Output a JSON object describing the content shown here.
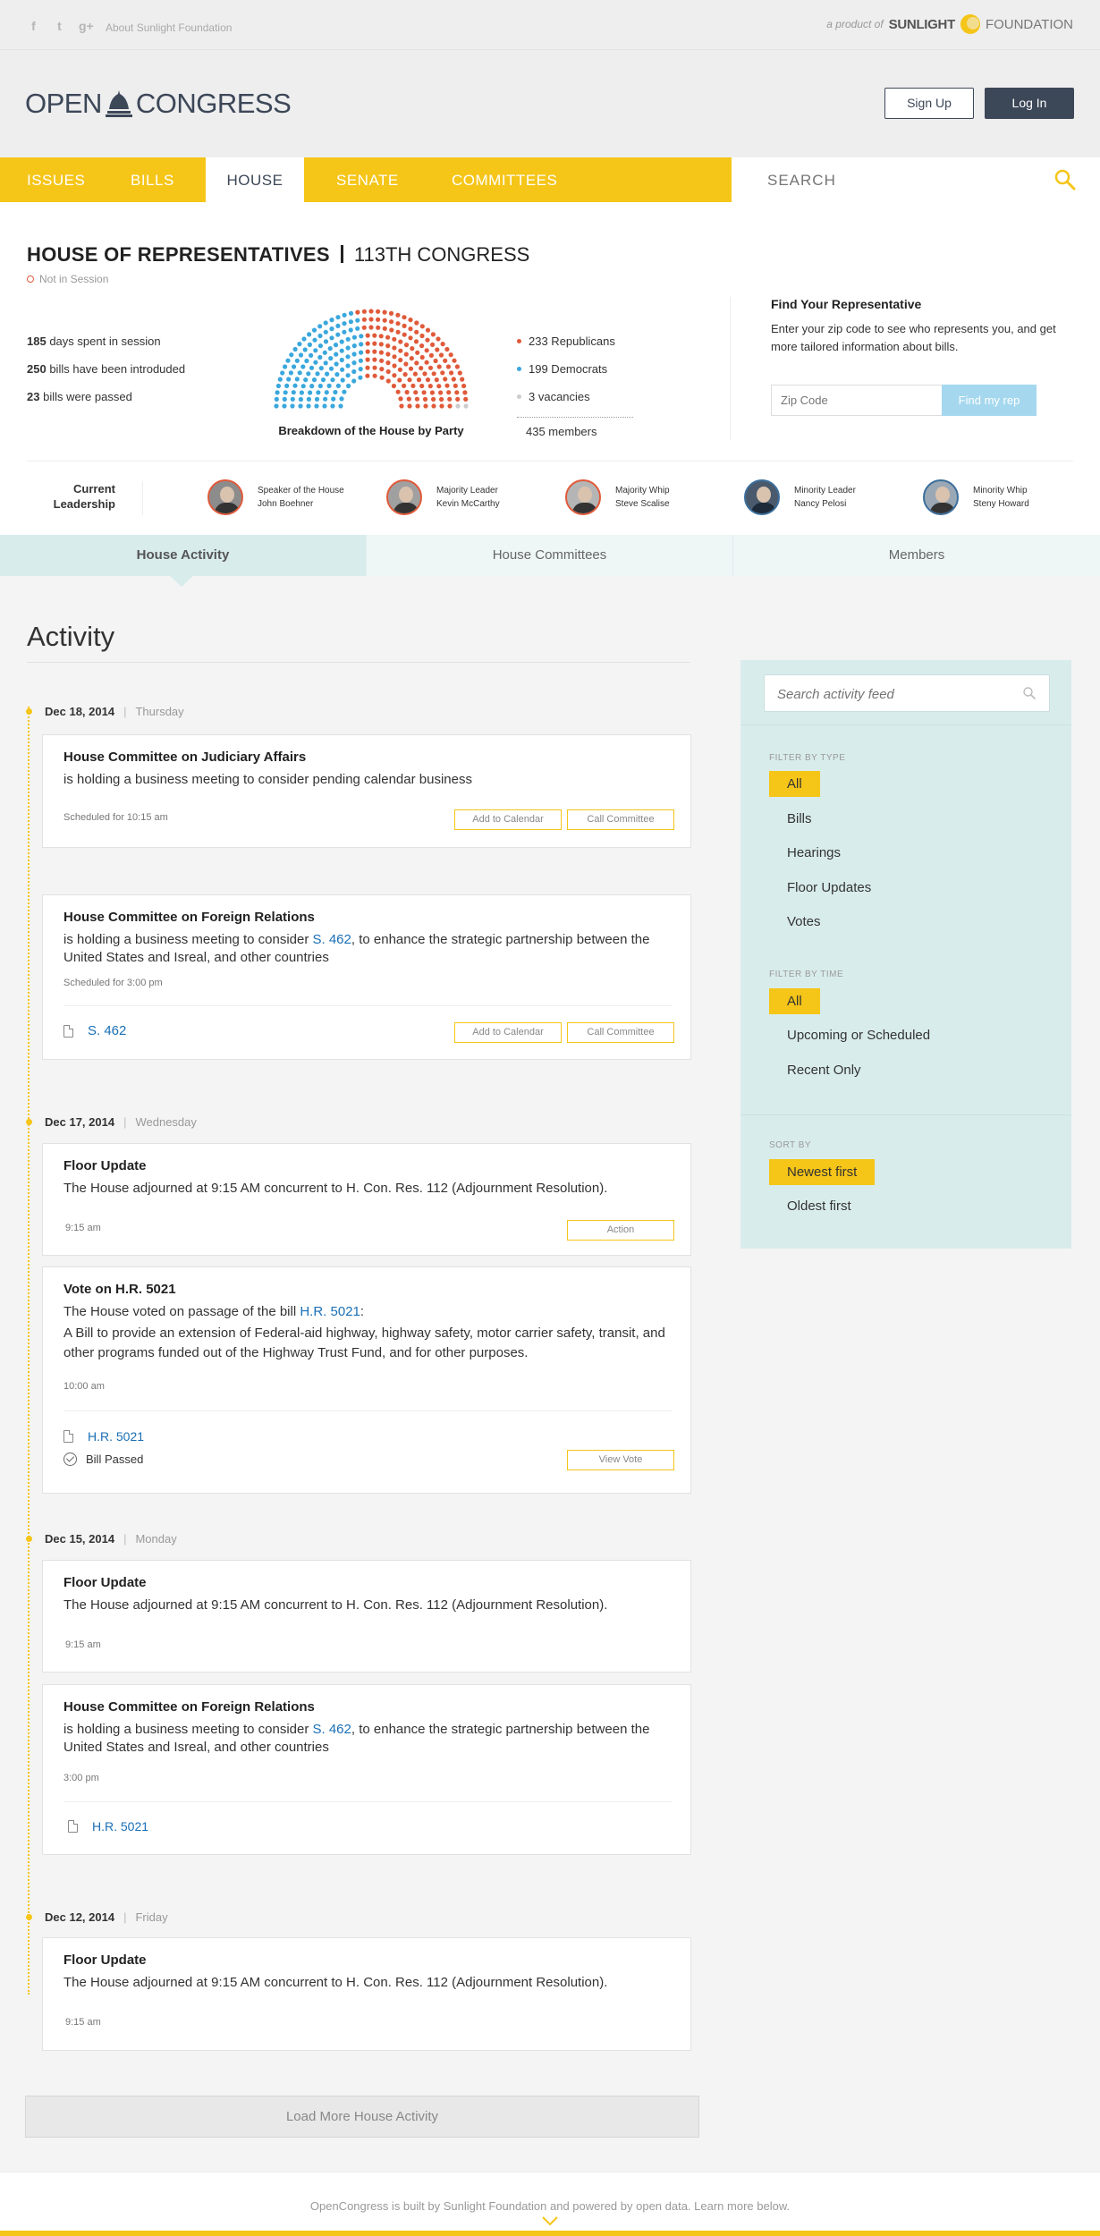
{
  "topbar": {
    "social": [
      "facebook-icon",
      "twitter-icon",
      "google-plus-icon"
    ],
    "social_glyphs": [
      "f",
      "t",
      "g+"
    ],
    "about_link": "About Sunlight Foundation",
    "product_prefix": "a product of",
    "product_name": "SUNLIGHT",
    "product_suffix": "FOUNDATION"
  },
  "header": {
    "logo_left": "OPEN",
    "logo_right": "CONGRESS",
    "signup_label": "Sign Up",
    "login_label": "Log In"
  },
  "nav": {
    "items": [
      "ISSUES",
      "BILLS",
      "HOUSE",
      "SENATE",
      "COMMITTEES"
    ],
    "active": "HOUSE",
    "search_placeholder": "SEARCH"
  },
  "house": {
    "title": "HOUSE OF REPRESENTATIVES",
    "congress": "113TH CONGRESS",
    "session_status": "Not in Session",
    "stats": [
      {
        "num": "185",
        "text": "days spent in session"
      },
      {
        "num": "250",
        "text": "bills have been introduded"
      },
      {
        "num": "23",
        "text": "bills were passed"
      }
    ],
    "chart_caption": "Breakdown of the House by Party",
    "legend": [
      {
        "label": "233 Republicans",
        "color": "#e05a3a"
      },
      {
        "label": "199 Democrats",
        "color": "#3aa7dd"
      },
      {
        "label": "3 vacancies",
        "color": "#cccccc"
      }
    ],
    "members_total": "435 members"
  },
  "chart_data": {
    "type": "pie",
    "categories": [
      "Republicans",
      "Democrats",
      "vacancies"
    ],
    "values": [
      233,
      199,
      3
    ],
    "colors": [
      "#e05a3a",
      "#3aa7dd",
      "#cccccc"
    ],
    "title": "Breakdown of the House by Party"
  },
  "find_rep": {
    "title": "Find Your Representative",
    "description": "Enter your zip code to see who represents you, and get more tailored information about bills.",
    "zip_placeholder": "Zip Code",
    "button_label": "Find my rep"
  },
  "leadership": {
    "label_line1": "Current",
    "label_line2": "Leadership",
    "leaders": [
      {
        "role": "Speaker of the House",
        "name": "John Boehner",
        "ring": "#e05a3a"
      },
      {
        "role": "Majority Leader",
        "name": "Kevin McCarthy",
        "ring": "#e05a3a"
      },
      {
        "role": "Majority Whip",
        "name": "Steve Scalise",
        "ring": "#e05a3a"
      },
      {
        "role": "Minority Leader",
        "name": "Nancy Pelosi",
        "ring": "#3c6e9b"
      },
      {
        "role": "Minority Whip",
        "name": "Steny Howard",
        "ring": "#3c6e9b"
      }
    ]
  },
  "tabs": [
    "House Activity",
    "House Committees",
    "Members"
  ],
  "activity": {
    "title": "Activity",
    "days": [
      {
        "date": "Dec 18, 2014",
        "dow": "Thursday"
      },
      {
        "date": "Dec 17, 2014",
        "dow": "Wednesday"
      },
      {
        "date": "Dec 15, 2014",
        "dow": "Monday"
      },
      {
        "date": "Dec 12, 2014",
        "dow": "Friday"
      }
    ],
    "cards": [
      {
        "title": "House Committee on Judiciary Affairs",
        "text": "is holding a business meeting to consider pending calendar business",
        "meta": "Scheduled for 10:15 am",
        "btn1": "Add to Calendar",
        "btn2": "Call Committee"
      },
      {
        "title": "House Committee on Foreign Relations",
        "text_pre": "is holding a business meeting to consider ",
        "link": "S. 462",
        "text_post": ", to enhance the strategic partnership between the United States and Isreal, and other countries",
        "meta": "Scheduled for 3:00 pm",
        "doc": "S. 462",
        "btn1": "Add to Calendar",
        "btn2": "Call Committee"
      },
      {
        "title": "Floor Update",
        "text": "The House adjourned at 9:15 AM concurrent to H. Con. Res. 112 (Adjournment Resolution).",
        "meta": "9:15 am",
        "btn1": "Action"
      },
      {
        "title": "Vote on H.R. 5021",
        "text_pre": "The House voted on passage of the bill ",
        "link": "H.R. 5021",
        "text_post": ":",
        "text2": "A Bill to provide an extension of Federal-aid highway, highway safety, motor carrier safety, transit, and other programs funded out of the Highway Trust Fund, and for other purposes.",
        "meta": "10:00 am",
        "doc": "H.R. 5021",
        "status": "Bill Passed",
        "btn1": "View Vote"
      },
      {
        "title": "Floor Update",
        "text": "The House adjourned at 9:15 AM concurrent to H. Con. Res. 112 (Adjournment Resolution).",
        "meta": "9:15 am"
      },
      {
        "title": "House Committee on Foreign Relations",
        "text_pre": "is holding a business meeting to consider ",
        "link": "S. 462",
        "text_post": ", to enhance the strategic partnership between the United States and Isreal, and other countries",
        "meta": "3:00 pm",
        "doc": "H.R. 5021"
      },
      {
        "title": "Floor Update",
        "text": "The House adjourned at 9:15 AM concurrent to H. Con. Res. 112 (Adjournment Resolution).",
        "meta": "9:15 am"
      }
    ],
    "load_more": "Load More House Activity"
  },
  "sidebar": {
    "search_placeholder": "Search activity feed",
    "filter_type_head": "FILTER BY TYPE",
    "filter_type": [
      "All",
      "Bills",
      "Hearings",
      "Floor Updates",
      "Votes"
    ],
    "filter_time_head": "FILTER BY TIME",
    "filter_time": [
      "All",
      "Upcoming or Scheduled",
      "Recent Only"
    ],
    "sort_head": "SORT BY",
    "sort": [
      "Newest first",
      "Oldest first"
    ]
  },
  "footer": {
    "text": "OpenCongress is built by Sunlight Foundation and powered by open data. Learn more below."
  }
}
